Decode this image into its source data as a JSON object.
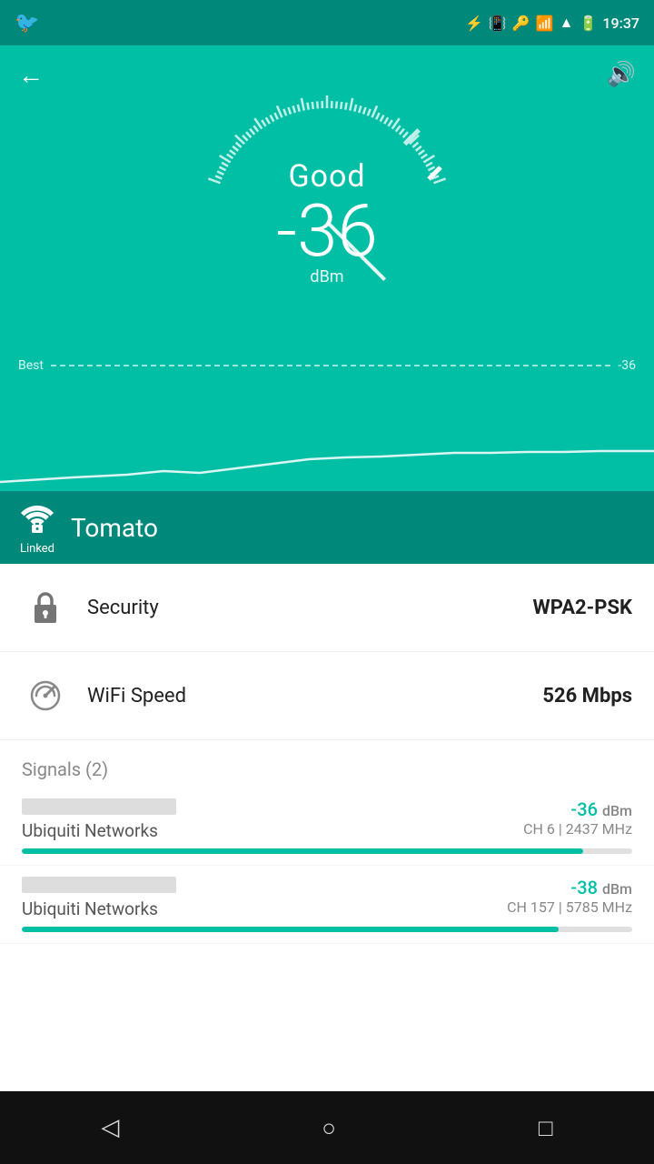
{
  "statusBar": {
    "time": "19:37",
    "twitter_icon": "🐦"
  },
  "header": {
    "back_label": "←",
    "sound_label": "🔊"
  },
  "gauge": {
    "quality_label": "Good",
    "value": "-36",
    "unit": "dBm",
    "best_label": "Best",
    "best_value": "-36"
  },
  "network": {
    "name": "Tomato",
    "linked_label": "Linked"
  },
  "security": {
    "label": "Security",
    "value": "WPA2-PSK"
  },
  "wifi_speed": {
    "label": "WiFi Speed",
    "value": "526 Mbps"
  },
  "signals": {
    "header": "Signals (2)",
    "items": [
      {
        "network": "Ubiquiti Networks",
        "dbm_value": "-36",
        "dbm_unit": "dBm",
        "channel": "CH 6 | 2437 MHz",
        "bar_pct": 92
      },
      {
        "network": "Ubiquiti Networks",
        "dbm_value": "-38",
        "dbm_unit": "dBm",
        "channel": "CH 157 | 5785 MHz",
        "bar_pct": 88
      }
    ]
  },
  "nav": {
    "back": "◁",
    "home": "○",
    "recent": "□"
  }
}
